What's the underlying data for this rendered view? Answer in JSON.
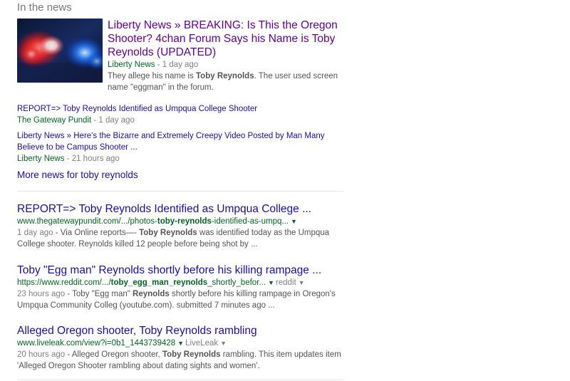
{
  "news": {
    "section_title": "In the news",
    "top_story": {
      "title": "Liberty News » BREAKING: Is This the Oregon Shooter? 4chan Forum Says his Name is Toby Reynolds (UPDATED)",
      "source": "Liberty News",
      "time": " - 1 day ago",
      "snippet_pre": "They allege his name is ",
      "snippet_bold": "Toby Reynolds",
      "snippet_post": ". The user used screen name \"eggman\" in the forum.",
      "thumbnail_icon": "police-lights-image"
    },
    "items": [
      {
        "title": "REPORT=> Toby Reynolds Identified as Umpqua College Shooter",
        "source": "The Gateway Pundit",
        "time": " - 1 day ago"
      },
      {
        "title": "Liberty News » Here's the Bizarre and Extremely Creepy Video Posted by Man Many Believe to be Campus Shooter ...",
        "source": "Liberty News",
        "time": " - 21 hours ago"
      }
    ],
    "more_link": "More news for toby reynolds"
  },
  "results": [
    {
      "title": "REPORT=> Toby Reynolds Identified as Umpqua College ...",
      "url_pre": "www.thegatewaypundit.com/.../photos-",
      "url_bold": "toby-reynolds",
      "url_post": "-identified-as-umpq...",
      "extra": "",
      "date": "1 day ago",
      "snippet_a": " - Via Online reports—- ",
      "snippet_bold": "Toby Reynolds",
      "snippet_b": " was identified today as the Umpqua College shooter. Reynolds killed 12 people before being shot by ..."
    },
    {
      "title": "Toby \"Egg man\" Reynolds shortly before his killing rampage ...",
      "url_pre": "https://www.reddit.com/.../",
      "url_bold": "toby_egg_man_reynolds",
      "url_post": "_shortly_befor...",
      "extra": "reddit",
      "date": "23 hours ago",
      "snippet_a": " - Toby \"Egg man\" ",
      "snippet_bold": "Reynolds",
      "snippet_b": " shortly before his killing rampage in Oregon's Umpqua Community Colleg (youtube.com). submitted 7 minutes ago ..."
    },
    {
      "title": "Alleged Oregon shooter, Toby Reynolds rambling",
      "url_pre": "www.liveleak.com/view?i=0b1_1443739428",
      "url_bold": "",
      "url_post": "",
      "extra": "LiveLeak",
      "date": "20 hours ago",
      "snippet_a": " - Alleged Oregon shooter, ",
      "snippet_bold": "Toby Reynolds",
      "snippet_b": " rambling. This item updates item 'Alleged Oregon Shooter rambling about dating sights and women'."
    }
  ],
  "colors": {
    "link": "#1a0dab",
    "visited": "#660099",
    "url_green": "#006621",
    "snippet": "#545454"
  }
}
